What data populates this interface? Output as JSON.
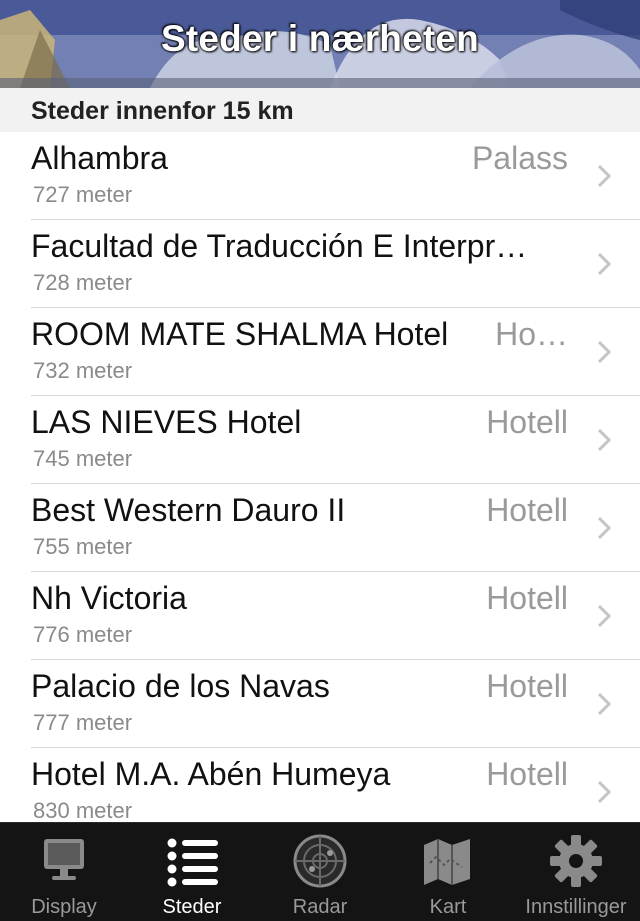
{
  "header": {
    "title": "Steder i nærheten"
  },
  "section": {
    "label": "Steder innenfor 15 km"
  },
  "places": [
    {
      "name": "Alhambra",
      "distance": "727 meter",
      "category": "Palass"
    },
    {
      "name": "Facultad de Traducción E Interpr…",
      "distance": "728 meter",
      "category": ""
    },
    {
      "name": "ROOM MATE SHALMA Hotel",
      "distance": "732 meter",
      "category": "Ho…"
    },
    {
      "name": "LAS NIEVES Hotel",
      "distance": "745 meter",
      "category": "Hotell"
    },
    {
      "name": "Best Western Dauro II",
      "distance": "755 meter",
      "category": "Hotell"
    },
    {
      "name": "Nh Victoria",
      "distance": "776 meter",
      "category": "Hotell"
    },
    {
      "name": "Palacio de los Navas",
      "distance": "777 meter",
      "category": "Hotell"
    },
    {
      "name": "Hotel M.A. Abén Humeya",
      "distance": "830 meter",
      "category": "Hotell"
    }
  ],
  "tabs": [
    {
      "label": "Display",
      "icon": "monitor-icon",
      "active": false
    },
    {
      "label": "Steder",
      "icon": "list-icon",
      "active": true
    },
    {
      "label": "Radar",
      "icon": "radar-icon",
      "active": false
    },
    {
      "label": "Kart",
      "icon": "map-icon",
      "active": false
    },
    {
      "label": "Innstillinger",
      "icon": "gear-icon",
      "active": false
    }
  ],
  "colors": {
    "tabbar": "#141414",
    "active_tab": "#ffffff",
    "inactive_tab": "#9a9a9a"
  }
}
